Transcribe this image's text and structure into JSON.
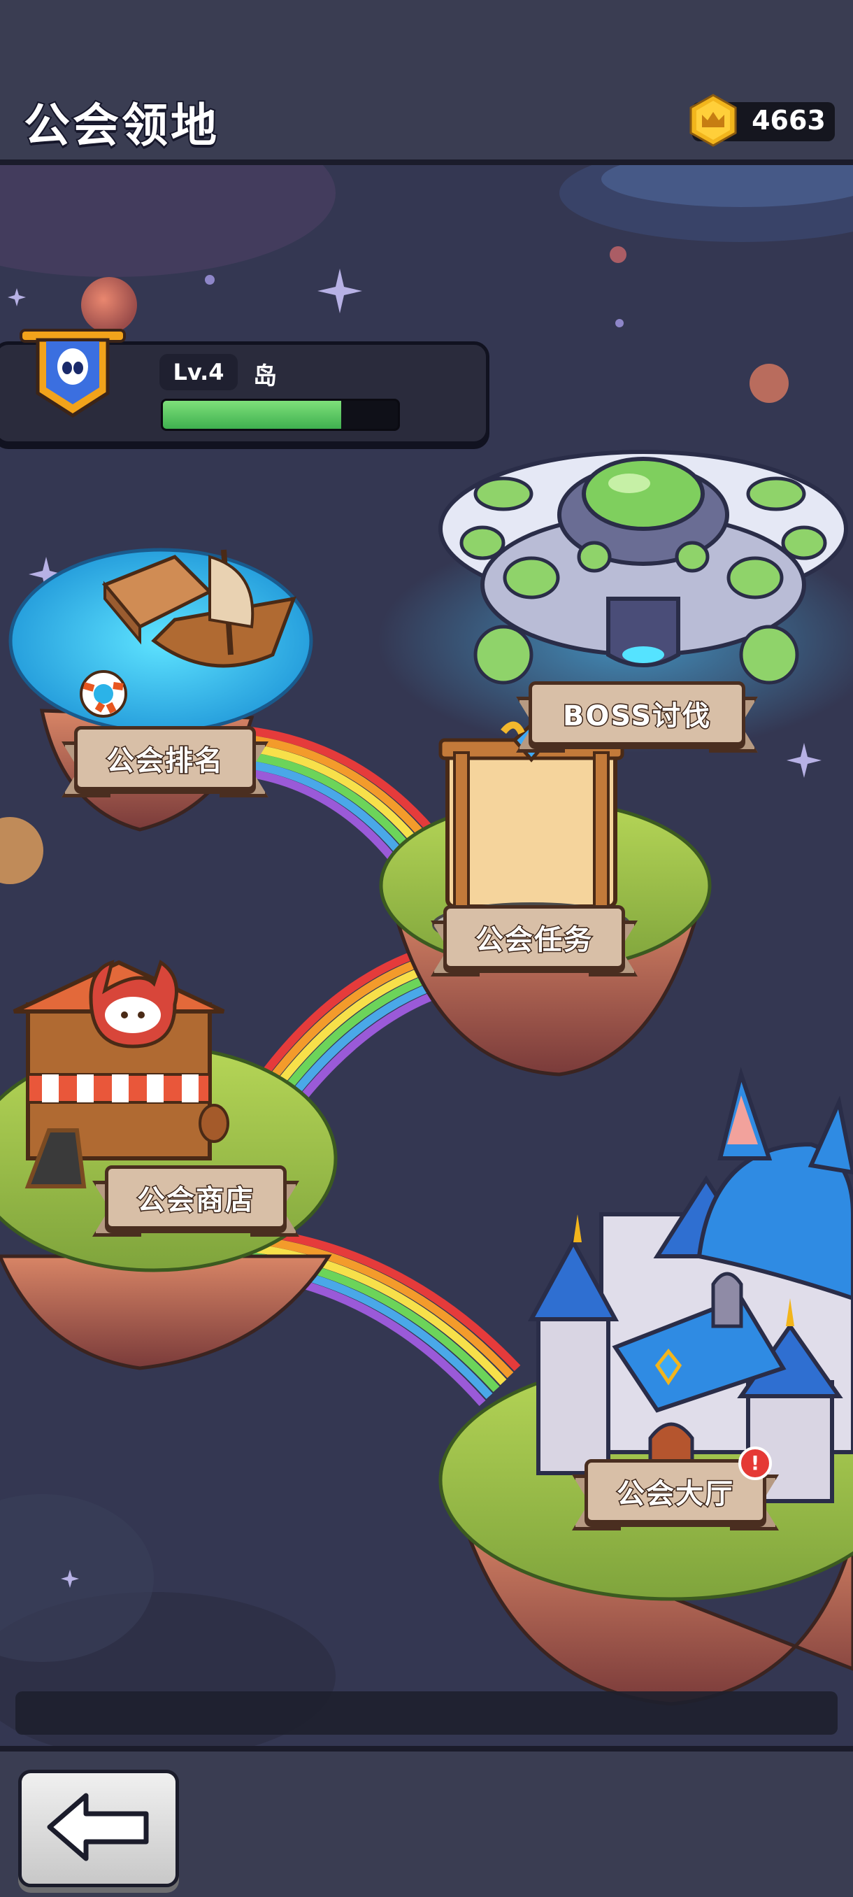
{
  "header": {
    "title": "公会领地",
    "currency_value": "4663",
    "currency_icon": "crown-coin-icon"
  },
  "guild": {
    "level": "Lv.4",
    "name": "岛",
    "exp_fraction": 0.76,
    "emblem_icon": "alien-shield-banner-icon"
  },
  "locations": {
    "boss": "BOSS讨伐",
    "ranking": "公会排名",
    "tasks": "公会任务",
    "shop": "公会商店",
    "hall": "公会大厅"
  },
  "hall_alert": "!",
  "nav": {
    "back_icon": "back-arrow-icon"
  }
}
